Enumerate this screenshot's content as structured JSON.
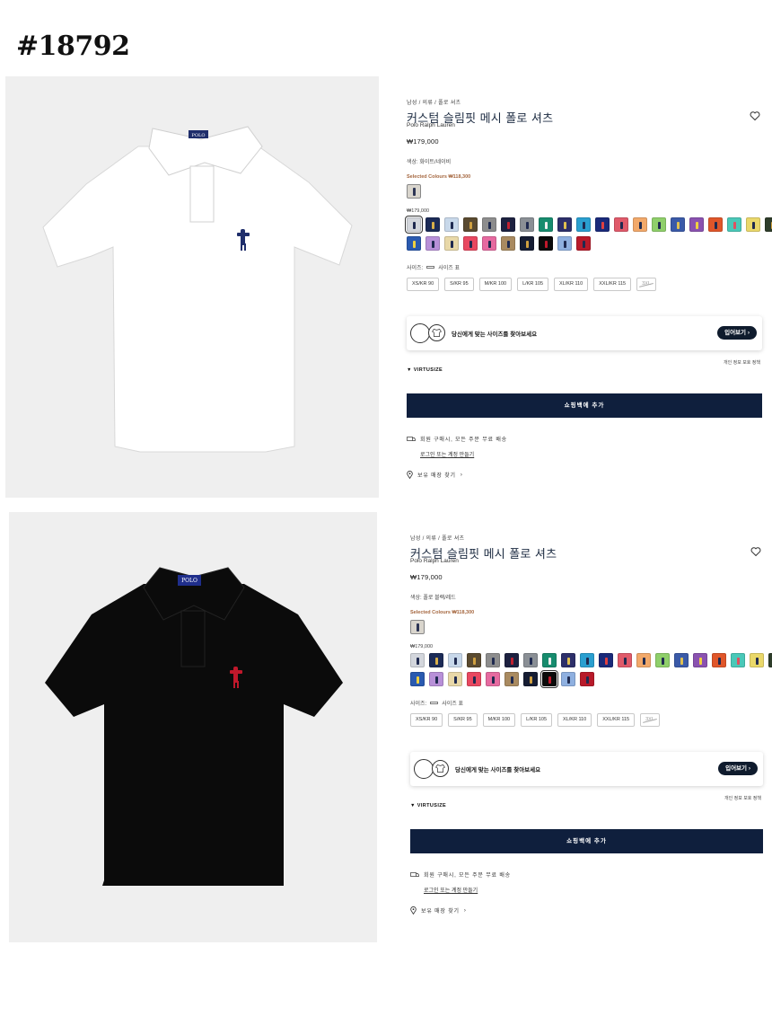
{
  "post_number": "#18792",
  "panels": [
    {
      "variant": "white",
      "breadcrumb": "남성 / 의류 / 폴로 셔츠",
      "title": "커스텀 슬림핏 메시 폴로 셔츠",
      "brand": "Polo Ralph Lauren",
      "price": "₩179,000",
      "color_label": "색상: 화이트/네이비",
      "selected_colours_label": "Selected Colours ₩118,300",
      "swatch_price": "₩179,000",
      "size_label": "사이즈:",
      "size_chart_label": "사이즈 표",
      "sizes": [
        "XS/KR 90",
        "S/KR 95",
        "M/KR 100",
        "L/KR 105",
        "XL/KR 110",
        "XXL/KR 115",
        "3XL"
      ],
      "virtusize_prompt": "당신에게 맞는 사이즈를 찾아보세요",
      "virtusize_button": "입어보기",
      "virtusize_logo": "VIRTUSIZE",
      "privacy_link": "개인 정보 보호 정책",
      "add_to_cart": "쇼핑백에 추가",
      "shipping": "회원 구매시, 모든 주문 무료 배송",
      "login_prefix": "로그인 또는 ",
      "login_link": "계정 만들기",
      "store_finder": "보유 매장 찾기",
      "shirt_color": "#ffffff",
      "pony_color": "#1f2e6b"
    },
    {
      "variant": "black",
      "breadcrumb": "남성 / 의류 / 폴로 셔츠",
      "title": "커스텀 슬림핏 메시 폴로 셔츠",
      "brand": "Polo Ralph Lauren",
      "price": "₩179,000",
      "color_label": "색상: 폴로 블랙/레드",
      "selected_colours_label": "Selected Colours ₩118,300",
      "swatch_price": "₩179,000",
      "size_label": "사이즈:",
      "size_chart_label": "사이즈 표",
      "sizes": [
        "XS/KR 90",
        "S/KR 95",
        "M/KR 100",
        "L/KR 105",
        "XL/KR 110",
        "XXL/KR 115",
        "3XL"
      ],
      "virtusize_prompt": "당신에게 맞는 사이즈를 찾아보세요",
      "virtusize_button": "입어보기",
      "virtusize_logo": "VIRTUSIZE",
      "privacy_link": "개인 정보 보호 정책",
      "add_to_cart": "쇼핑백에 추가",
      "shipping": "회원 구매시, 모든 주문 무료 배송",
      "login_prefix": "로그인 또는 ",
      "login_link": "계정 만들기",
      "store_finder": "보유 매장 찾기",
      "shirt_color": "#0b0b0b",
      "pony_color": "#c0182b"
    }
  ],
  "swatches": [
    {
      "bg": "#d3d6dc",
      "pony": "#1f2a50"
    },
    {
      "bg": "#1c2b57",
      "pony": "#d9b04a"
    },
    {
      "bg": "#c8d8ea",
      "pony": "#1f2a50"
    },
    {
      "bg": "#5a4a30",
      "pony": "#d0a040"
    },
    {
      "bg": "#8d8d8d",
      "pony": "#1f2a50"
    },
    {
      "bg": "#1d2140",
      "pony": "#c02030"
    },
    {
      "bg": "#8a8f95",
      "pony": "#1f2a50"
    },
    {
      "bg": "#178c6e",
      "pony": "#f0f0f0"
    },
    {
      "bg": "#2d2f6a",
      "pony": "#e0c050"
    },
    {
      "bg": "#2a9fd0",
      "pony": "#1f2a50"
    },
    {
      "bg": "#1a2a7a",
      "pony": "#e04040"
    },
    {
      "bg": "#e05a6a",
      "pony": "#1f2a50"
    },
    {
      "bg": "#f2a96a",
      "pony": "#1f2a50"
    },
    {
      "bg": "#8fcf6a",
      "pony": "#1f2a50"
    },
    {
      "bg": "#3a5aa8",
      "pony": "#e0c050"
    },
    {
      "bg": "#8a52b0",
      "pony": "#f0d040"
    },
    {
      "bg": "#e0562a",
      "pony": "#1f2a50"
    },
    {
      "bg": "#4ac8b8",
      "pony": "#e05060"
    },
    {
      "bg": "#ead86a",
      "pony": "#1f2a50"
    },
    {
      "bg": "#2e3d2a",
      "pony": "#d0a040"
    },
    {
      "bg": "#0f4a35",
      "pony": "#f0f0f0"
    },
    {
      "bg": "#2a5ab0",
      "pony": "#f0d040"
    },
    {
      "bg": "#b890d8",
      "pony": "#1f2a50"
    },
    {
      "bg": "#e8d8a8",
      "pony": "#1f2a50"
    },
    {
      "bg": "#e84860",
      "pony": "#1f2a50"
    },
    {
      "bg": "#e66aa0",
      "pony": "#1f2a50"
    },
    {
      "bg": "#a98a60",
      "pony": "#1f2a50"
    },
    {
      "bg": "#161d33",
      "pony": "#d0a040"
    },
    {
      "bg": "#0b0b0b",
      "pony": "#c0182b"
    },
    {
      "bg": "#8fb0e0",
      "pony": "#1f2a50"
    },
    {
      "bg": "#b81a2a",
      "pony": "#1f2a50"
    }
  ]
}
